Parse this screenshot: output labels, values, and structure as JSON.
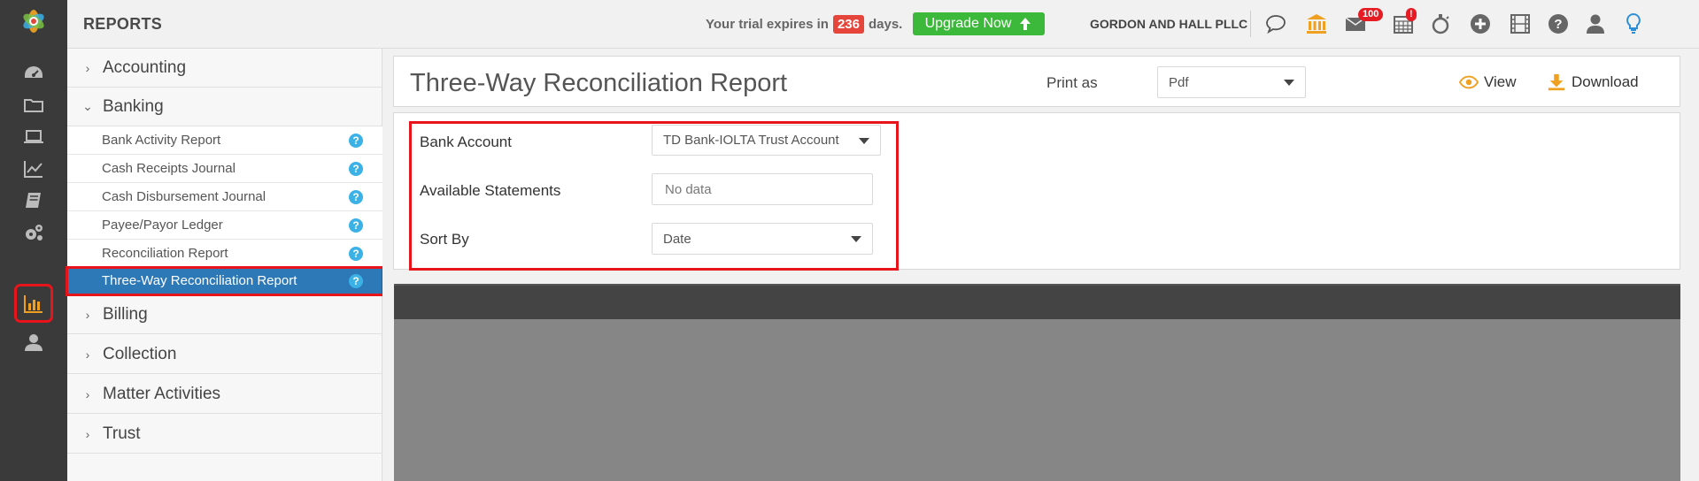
{
  "app": {
    "section_title": "REPORTS",
    "trial_prefix": "Your trial expires in",
    "trial_days": "236",
    "trial_suffix": "days.",
    "upgrade_label": "Upgrade Now",
    "firm_name": "GORDON AND HALL PLLC",
    "messages_badge": "100",
    "calendar_badge": "!"
  },
  "rail": {
    "icons": [
      "dashboard-icon",
      "folder-icon",
      "laptop-icon",
      "line-chart-icon",
      "book-icon",
      "cogs-icon",
      "bar-chart-icon",
      "user-icon"
    ],
    "active": "bar-chart-icon"
  },
  "top_icons": [
    "chat-icon",
    "bank-icon",
    "mail-icon",
    "calendar-icon",
    "stopwatch-icon",
    "plus-circle-icon",
    "film-icon",
    "help-icon",
    "user-icon",
    "lightbulb-icon"
  ],
  "menu": {
    "groups": [
      {
        "label": "Accounting",
        "expanded": false
      },
      {
        "label": "Banking",
        "expanded": true
      },
      {
        "label": "Billing",
        "expanded": false
      },
      {
        "label": "Collection",
        "expanded": false
      },
      {
        "label": "Matter Activities",
        "expanded": false
      },
      {
        "label": "Trust",
        "expanded": false
      }
    ],
    "banking_items": [
      "Bank Activity Report",
      "Cash Receipts Journal",
      "Cash Disbursement Journal",
      "Payee/Payor Ledger",
      "Reconciliation Report",
      "Three-Way Reconciliation Report"
    ],
    "selected_item": "Three-Way Reconciliation Report",
    "help_glyph": "?"
  },
  "report": {
    "title": "Three-Way Reconciliation Report",
    "print_as_label": "Print as",
    "print_format": "Pdf",
    "view_label": "View",
    "download_label": "Download"
  },
  "filters": {
    "bank_account_label": "Bank Account",
    "bank_account_value": "TD Bank-IOLTA Trust Account",
    "statements_label": "Available Statements",
    "statements_value": "No data",
    "sort_by_label": "Sort By",
    "sort_by_value": "Date"
  },
  "colors": {
    "rail_bg": "#3a3a3a",
    "accent_orange": "#f0a020",
    "upgrade_green": "#3cb93a",
    "selected_blue": "#2d79b8",
    "highlight_red": "#e8141b",
    "help_blue": "#3bb1e6"
  }
}
